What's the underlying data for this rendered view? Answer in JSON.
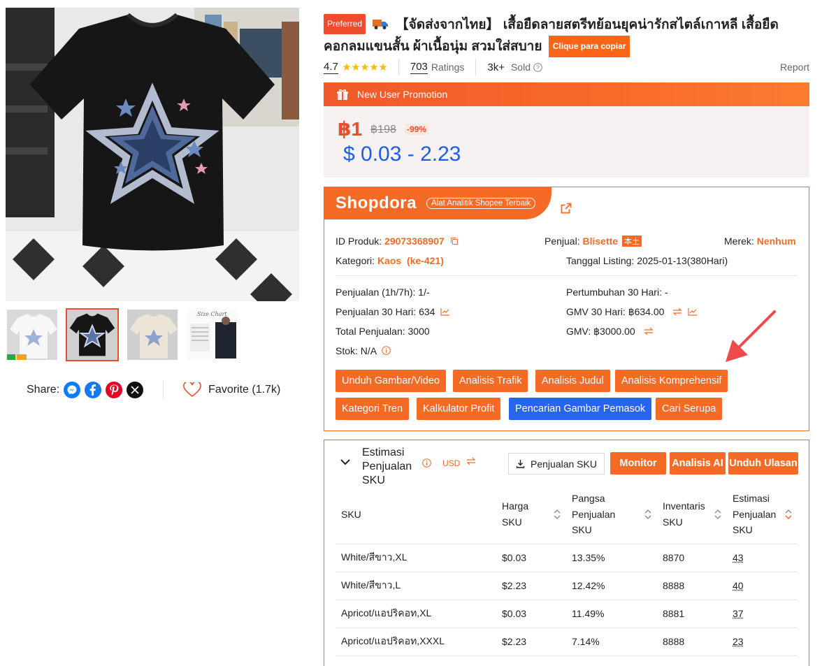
{
  "product": {
    "badge": "Preferred",
    "title": "【จัดส่งจากไทย】 เสื้อยืดลายสตรีทย้อนยุคน่ารักสไตล์เกาหลี เสื้อยืดคอกลมแขนสั้น ผ้าเนื้อนุ่ม สวมใส่สบาย",
    "copy_label": "Clique para copiar",
    "rating": "4.7",
    "ratings_count": "703",
    "ratings_label": "Ratings",
    "sold_count": "3k+",
    "sold_label": "Sold",
    "report_label": "Report"
  },
  "promo": {
    "label": "New User Promotion",
    "price": "฿1",
    "original_price": "฿198",
    "discount": "-99%",
    "usd_range": "$ 0.03 - 2.23"
  },
  "gallery": {
    "share_label": "Share:",
    "favorite_label": "Favorite (1.7k)",
    "size_chart_label": "Size Chart"
  },
  "shopdora": {
    "logo": "Shopdora",
    "tagline": "Alat Analitik Shopee Terbaik",
    "product_id_label": "ID Produk:",
    "product_id": "29073368907",
    "seller_label": "Penjual:",
    "seller": "Blisette",
    "seller_badge": "本土",
    "brand_label": "Merek:",
    "brand": "Nenhum",
    "category_label": "Kategori:",
    "category": "Kaos  (ke-421)",
    "listing_label": "Tanggal Listing:",
    "listing_value": "2025-01-13(380Hari)",
    "sales_1h7h": "Penjualan (1h/7h): 1/-",
    "growth_30d": "Pertumbuhan 30 Hari: -",
    "sales_30d": "Penjualan 30 Hari: 634",
    "gmv_30d": "GMV 30 Hari: ฿634.00",
    "total_sales": "Total Penjualan: 3000",
    "gmv": "GMV: ฿3000.00",
    "stock": "Stok: N/A",
    "buttons": [
      "Unduh Gambar/Video",
      "Analisis Trafik",
      "Analisis Judul",
      "Analisis Komprehensif",
      "Kategori Tren",
      "Kalkulator Profit",
      "Pencarian Gambar Pemasok",
      "Cari Serupa"
    ]
  },
  "sku": {
    "title": "Estimasi Penjualan SKU",
    "currency": "USD",
    "download_label": "Penjualan SKU",
    "monitor_label": "Monitor",
    "ai_label": "Analisis AI",
    "reviews_label": "Unduh Ulasan",
    "headers": [
      "SKU",
      "Harga SKU",
      "Pangsa Penjualan SKU",
      "Inventaris SKU",
      "Estimasi Penjualan SKU"
    ],
    "rows": [
      [
        "White/สีขาว,XL",
        "$0.03",
        "13.35%",
        "8870",
        "43"
      ],
      [
        "White/สีขาว,L",
        "$2.23",
        "12.42%",
        "8888",
        "40"
      ],
      [
        "Apricot/แอปริคอท,XL",
        "$0.03",
        "11.49%",
        "8881",
        "37"
      ],
      [
        "Apricot/แอปริคอท,XXXL",
        "$2.23",
        "7.14%",
        "8888",
        "23"
      ]
    ]
  },
  "colors": {
    "accent": "#ee4d2d",
    "shopdora": "#f56a24",
    "blue": "#2765f0"
  }
}
